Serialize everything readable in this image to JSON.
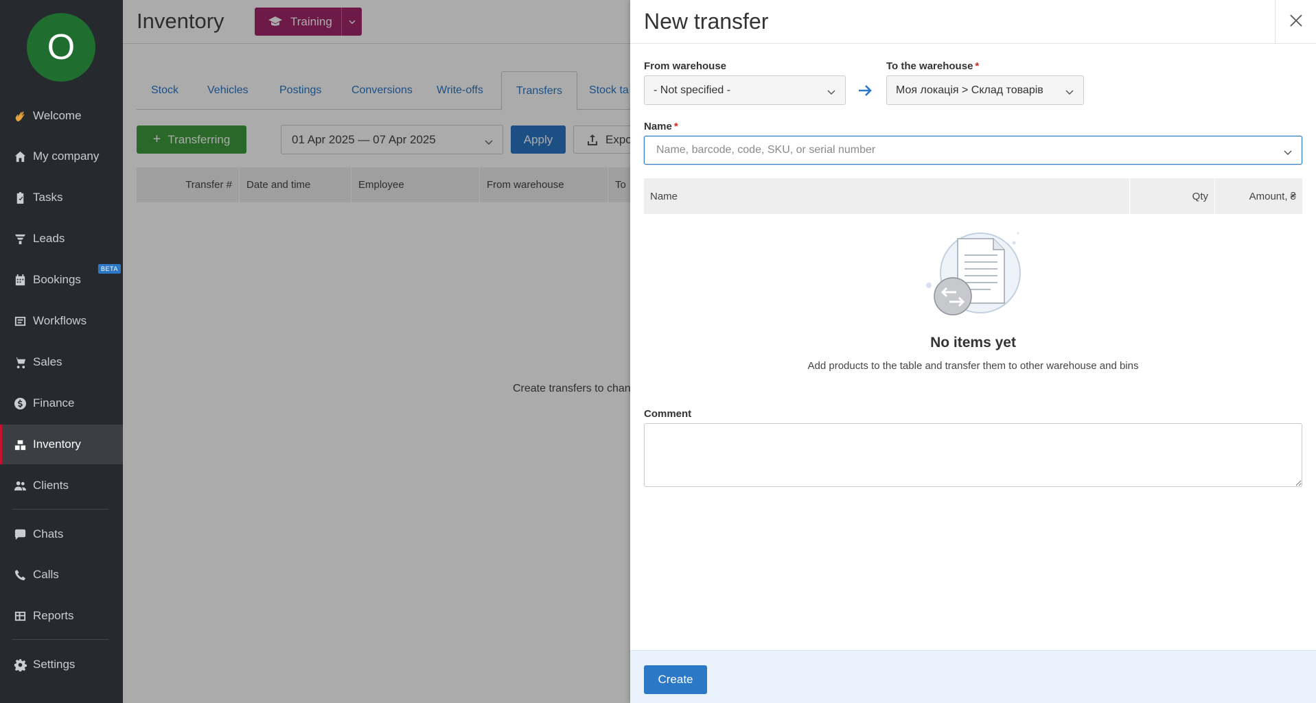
{
  "sidebar": {
    "avatar_letter": "O",
    "beta_badge": "BETA",
    "items": [
      {
        "label": "Welcome",
        "icon": "wave-icon"
      },
      {
        "label": "My company",
        "icon": "home-icon"
      },
      {
        "label": "Tasks",
        "icon": "clipboard-icon"
      },
      {
        "label": "Leads",
        "icon": "funnel-icon"
      },
      {
        "label": "Bookings",
        "icon": "calendar-icon"
      },
      {
        "label": "Workflows",
        "icon": "workflow-icon"
      },
      {
        "label": "Sales",
        "icon": "cart-icon"
      },
      {
        "label": "Finance",
        "icon": "dollar-icon"
      },
      {
        "label": "Inventory",
        "icon": "boxes-icon"
      },
      {
        "label": "Clients",
        "icon": "people-icon"
      },
      {
        "label": "Chats",
        "icon": "chat-icon"
      },
      {
        "label": "Calls",
        "icon": "phone-icon"
      },
      {
        "label": "Reports",
        "icon": "table-icon"
      },
      {
        "label": "Settings",
        "icon": "gear-icon"
      }
    ]
  },
  "main": {
    "title": "Inventory",
    "training_label": "Training",
    "tabs": [
      "Stock",
      "Vehicles",
      "Postings",
      "Conversions",
      "Write-offs",
      "Transfers",
      "Stock ta"
    ],
    "transferring_label": "Transferring",
    "date_range": "01 Apr 2025 — 07 Apr 2025",
    "apply_label": "Apply",
    "export_label": "Expo",
    "table_headers": [
      "Transfer #",
      "Date and time",
      "Employee",
      "From warehouse",
      "To"
    ],
    "empty_text": "Create transfers to chang"
  },
  "drawer": {
    "title": "New transfer",
    "from_label": "From warehouse",
    "from_value": "- Not specified -",
    "to_label": "To the warehouse",
    "to_value": "Моя локація > Склад товарів",
    "required_mark": "*",
    "name_label": "Name",
    "name_placeholder": "Name, barcode, code, SKU, or serial number",
    "columns": [
      "Name",
      "Qty",
      "Amount, ₴"
    ],
    "empty_title": "No items yet",
    "empty_sub": "Add products to the table and transfer them to other warehouse and bins",
    "comment_label": "Comment",
    "create_label": "Create"
  },
  "colors": {
    "accent": "#2b78c7",
    "training": "#a4286e",
    "transfer": "#3e9b3c",
    "sidebar": "#262a2e",
    "required": "#d9261c"
  }
}
